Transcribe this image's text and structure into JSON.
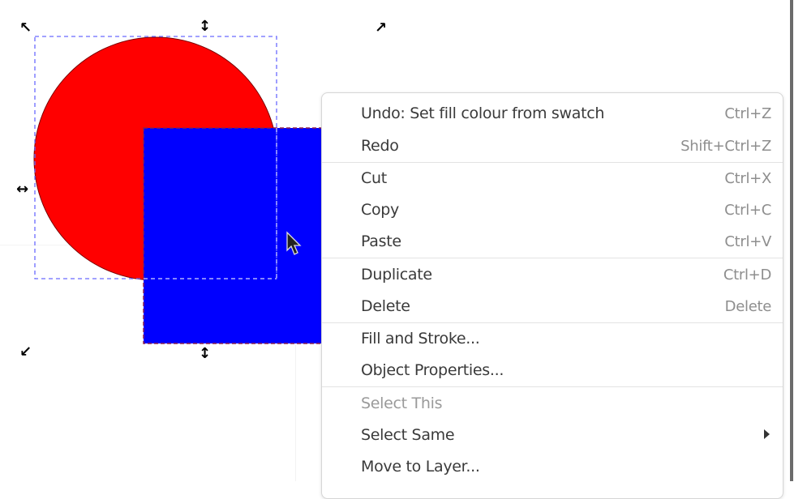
{
  "canvas": {
    "objects": [
      {
        "type": "circle",
        "fill": "#ff0000",
        "stroke": "#8b0000"
      },
      {
        "type": "rect",
        "fill": "#0000ff",
        "stroke": "#8b0000"
      }
    ],
    "selection_color": "#5a5aff",
    "handles": {
      "top_left": "↖",
      "top_mid": "↕",
      "top_right": "↗",
      "mid_left": "↔",
      "bottom_left": "↙",
      "bottom_mid": "↕"
    }
  },
  "context_menu": {
    "items": [
      {
        "label": "Undo: Set fill colour from swatch",
        "shortcut": "Ctrl+Z"
      },
      {
        "label": "Redo",
        "shortcut": "Shift+Ctrl+Z"
      },
      {
        "label": "Cut",
        "shortcut": "Ctrl+X"
      },
      {
        "label": "Copy",
        "shortcut": "Ctrl+C"
      },
      {
        "label": "Paste",
        "shortcut": "Ctrl+V"
      },
      {
        "label": "Duplicate",
        "shortcut": "Ctrl+D"
      },
      {
        "label": "Delete",
        "shortcut": "Delete"
      },
      {
        "label": "Fill and Stroke...",
        "shortcut": ""
      },
      {
        "label": "Object Properties...",
        "shortcut": ""
      },
      {
        "label": "Select This",
        "shortcut": "",
        "disabled": true
      },
      {
        "label": "Select Same",
        "shortcut": "",
        "submenu": true
      },
      {
        "label": "Move to Layer...",
        "shortcut": ""
      }
    ]
  }
}
